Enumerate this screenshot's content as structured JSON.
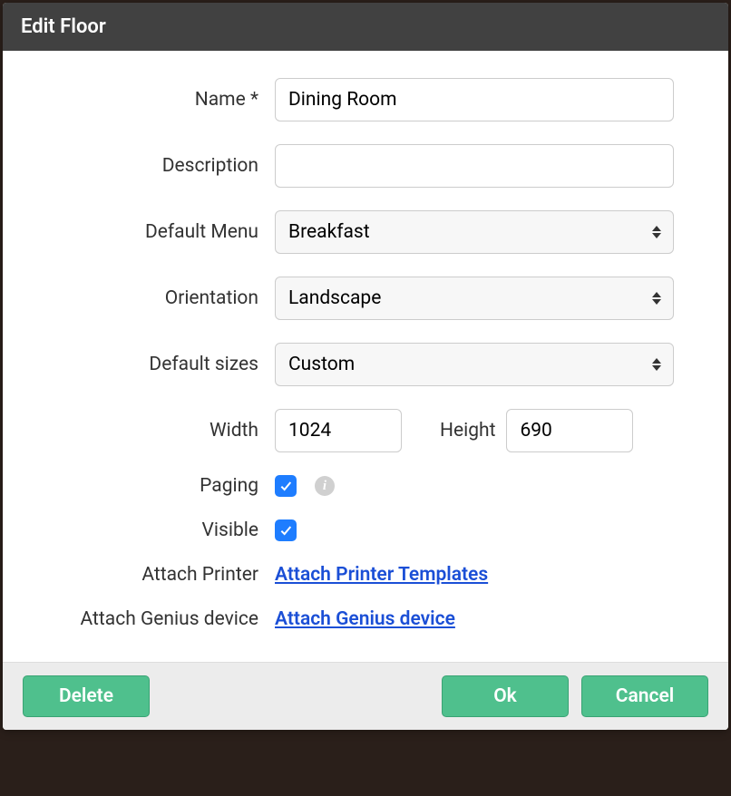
{
  "dialog": {
    "title": "Edit Floor"
  },
  "form": {
    "name": {
      "label": "Name *",
      "value": "Dining Room"
    },
    "description": {
      "label": "Description",
      "value": ""
    },
    "default_menu": {
      "label": "Default Menu",
      "value": "Breakfast"
    },
    "orientation": {
      "label": "Orientation",
      "value": "Landscape"
    },
    "default_sizes": {
      "label": "Default sizes",
      "value": "Custom"
    },
    "width": {
      "label": "Width",
      "value": "1024"
    },
    "height": {
      "label": "Height",
      "value": "690"
    },
    "paging": {
      "label": "Paging",
      "checked": true
    },
    "visible": {
      "label": "Visible",
      "checked": true
    },
    "attach_printer": {
      "label": "Attach Printer",
      "link": "Attach Printer Templates"
    },
    "attach_genius": {
      "label": "Attach Genius device",
      "link": "Attach Genius device"
    }
  },
  "footer": {
    "delete": "Delete",
    "ok": "Ok",
    "cancel": "Cancel"
  }
}
